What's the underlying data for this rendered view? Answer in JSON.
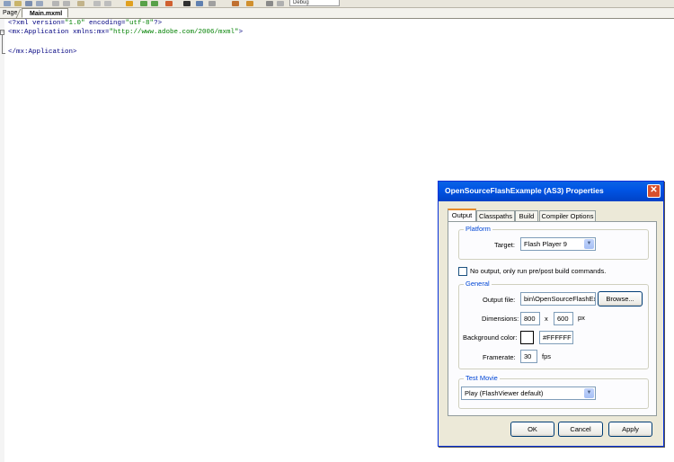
{
  "toolbar": {
    "config_combo": "Debug"
  },
  "editor_tabs": {
    "page_label": "Page",
    "main_label": "Main.mxml"
  },
  "code": {
    "line1_a": "<?xml version=",
    "line1_b": "\"1.0\"",
    "line1_c": " encoding=",
    "line1_d": "\"utf-8\"",
    "line1_e": "?>",
    "line2_a": "<mx:Application xmlns:mx=",
    "line2_b": "\"http://www.adobe.com/2006/mxml\"",
    "line2_c": ">",
    "line4": "</mx:Application>"
  },
  "dialog": {
    "title": "OpenSourceFlashExample (AS3) Properties",
    "close_glyph": "✕",
    "tabs": [
      "Output",
      "Classpaths",
      "Build",
      "Compiler Options"
    ],
    "platform": {
      "legend": "Platform",
      "target_label": "Target:",
      "target_value": "Flash Player 9"
    },
    "no_output_label": "No output, only run pre/post build commands.",
    "general": {
      "legend": "General",
      "output_file_label": "Output file:",
      "output_file_value": "bin\\OpenSourceFlashEx...",
      "browse_label": "Browse...",
      "dimensions_label": "Dimensions:",
      "width": "800",
      "x_label": "x",
      "height": "600",
      "px_label": "px",
      "bg_color_label": "Background color:",
      "bg_color_value": "#FFFFFF",
      "framerate_label": "Framerate:",
      "framerate_value": "30",
      "fps_label": "fps"
    },
    "test_movie": {
      "legend": "Test Movie",
      "value": "Play (FlashViewer default)"
    },
    "buttons": {
      "ok": "OK",
      "cancel": "Cancel",
      "apply": "Apply"
    }
  },
  "colors": {
    "title_bar": "#0055e5",
    "legend": "#0046d5",
    "dialog_bg": "#ece9d8"
  }
}
